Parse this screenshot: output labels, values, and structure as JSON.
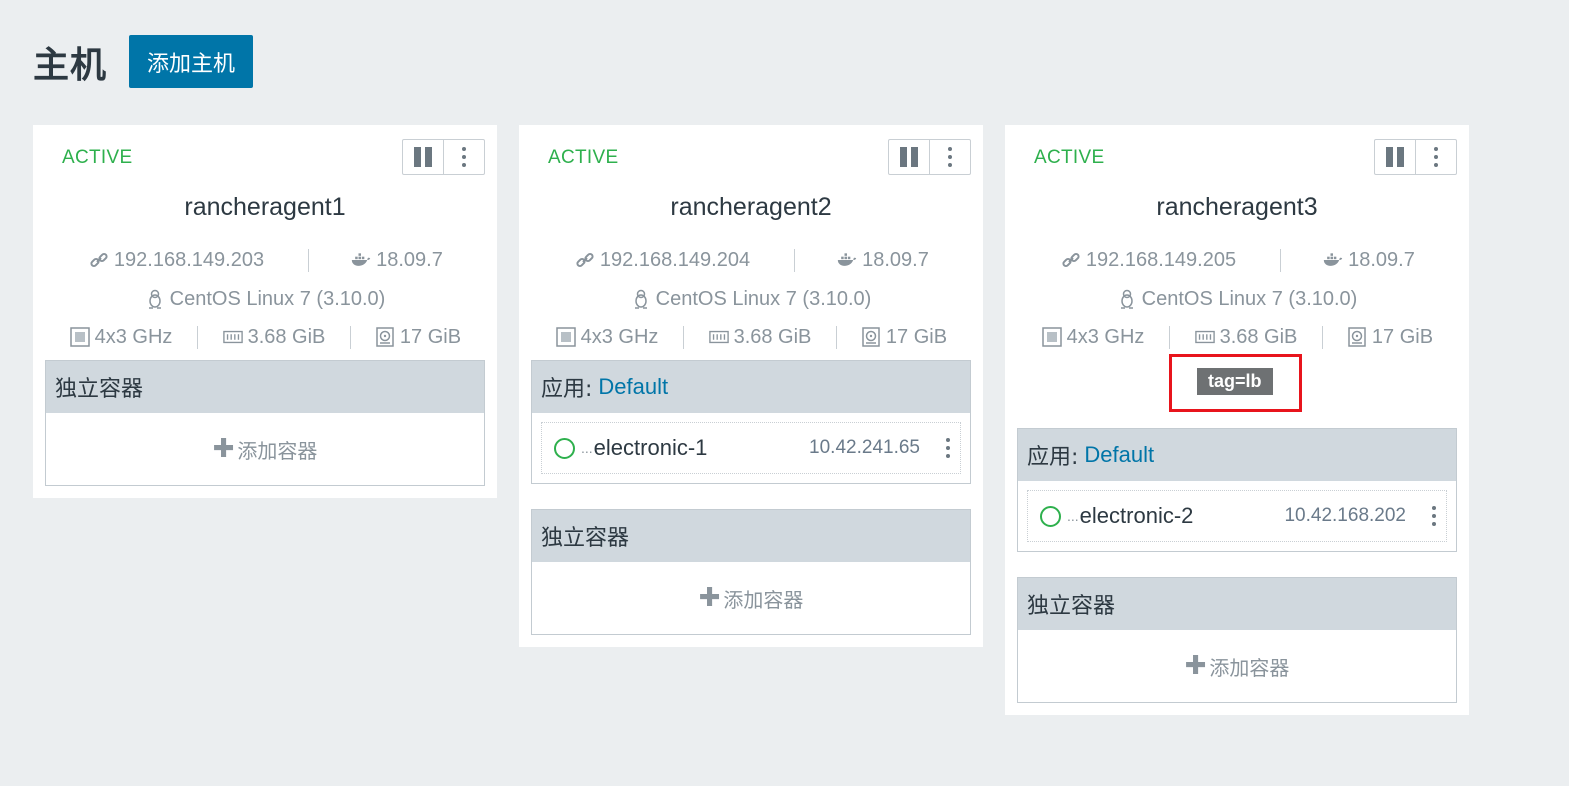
{
  "page": {
    "title": "主机",
    "add_host_label": "添加主机"
  },
  "icons": {
    "ip": "link-icon",
    "docker": "docker-whale-icon",
    "os": "linux-tux-icon",
    "cpu": "cpu-icon",
    "memory": "memory-icon",
    "disk": "disk-icon",
    "pause": "pause-icon",
    "menu": "vertical-ellipsis-icon",
    "add": "plus-icon"
  },
  "colors": {
    "active": "#2eb04d",
    "accent": "#0075a8",
    "highlight": "#e8141c"
  },
  "hosts": [
    {
      "state": "ACTIVE",
      "name": "rancheragent1",
      "ip": "192.168.149.203",
      "docker": "18.09.7",
      "os": "CentOS Linux 7 (3.10.0)",
      "cpu": "4x3 GHz",
      "memory": "3.68 GiB",
      "disk": "17 GiB",
      "standalone_header": "独立容器",
      "add_container": "添加容器"
    },
    {
      "state": "ACTIVE",
      "name": "rancheragent2",
      "ip": "192.168.149.204",
      "docker": "18.09.7",
      "os": "CentOS Linux 7 (3.10.0)",
      "cpu": "4x3 GHz",
      "memory": "3.68 GiB",
      "disk": "17 GiB",
      "stack_prefix": "应用:",
      "stack_name": "Default",
      "container": {
        "ellipsis": "...",
        "name": "electronic-1",
        "ip": "10.42.241.65"
      },
      "standalone_header": "独立容器",
      "add_container": "添加容器"
    },
    {
      "state": "ACTIVE",
      "name": "rancheragent3",
      "ip": "192.168.149.205",
      "docker": "18.09.7",
      "os": "CentOS Linux 7 (3.10.0)",
      "cpu": "4x3 GHz",
      "memory": "3.68 GiB",
      "disk": "17 GiB",
      "label": "tag=lb",
      "stack_prefix": "应用:",
      "stack_name": "Default",
      "container": {
        "ellipsis": "...",
        "name": "electronic-2",
        "ip": "10.42.168.202"
      },
      "standalone_header": "独立容器",
      "add_container": "添加容器"
    }
  ]
}
